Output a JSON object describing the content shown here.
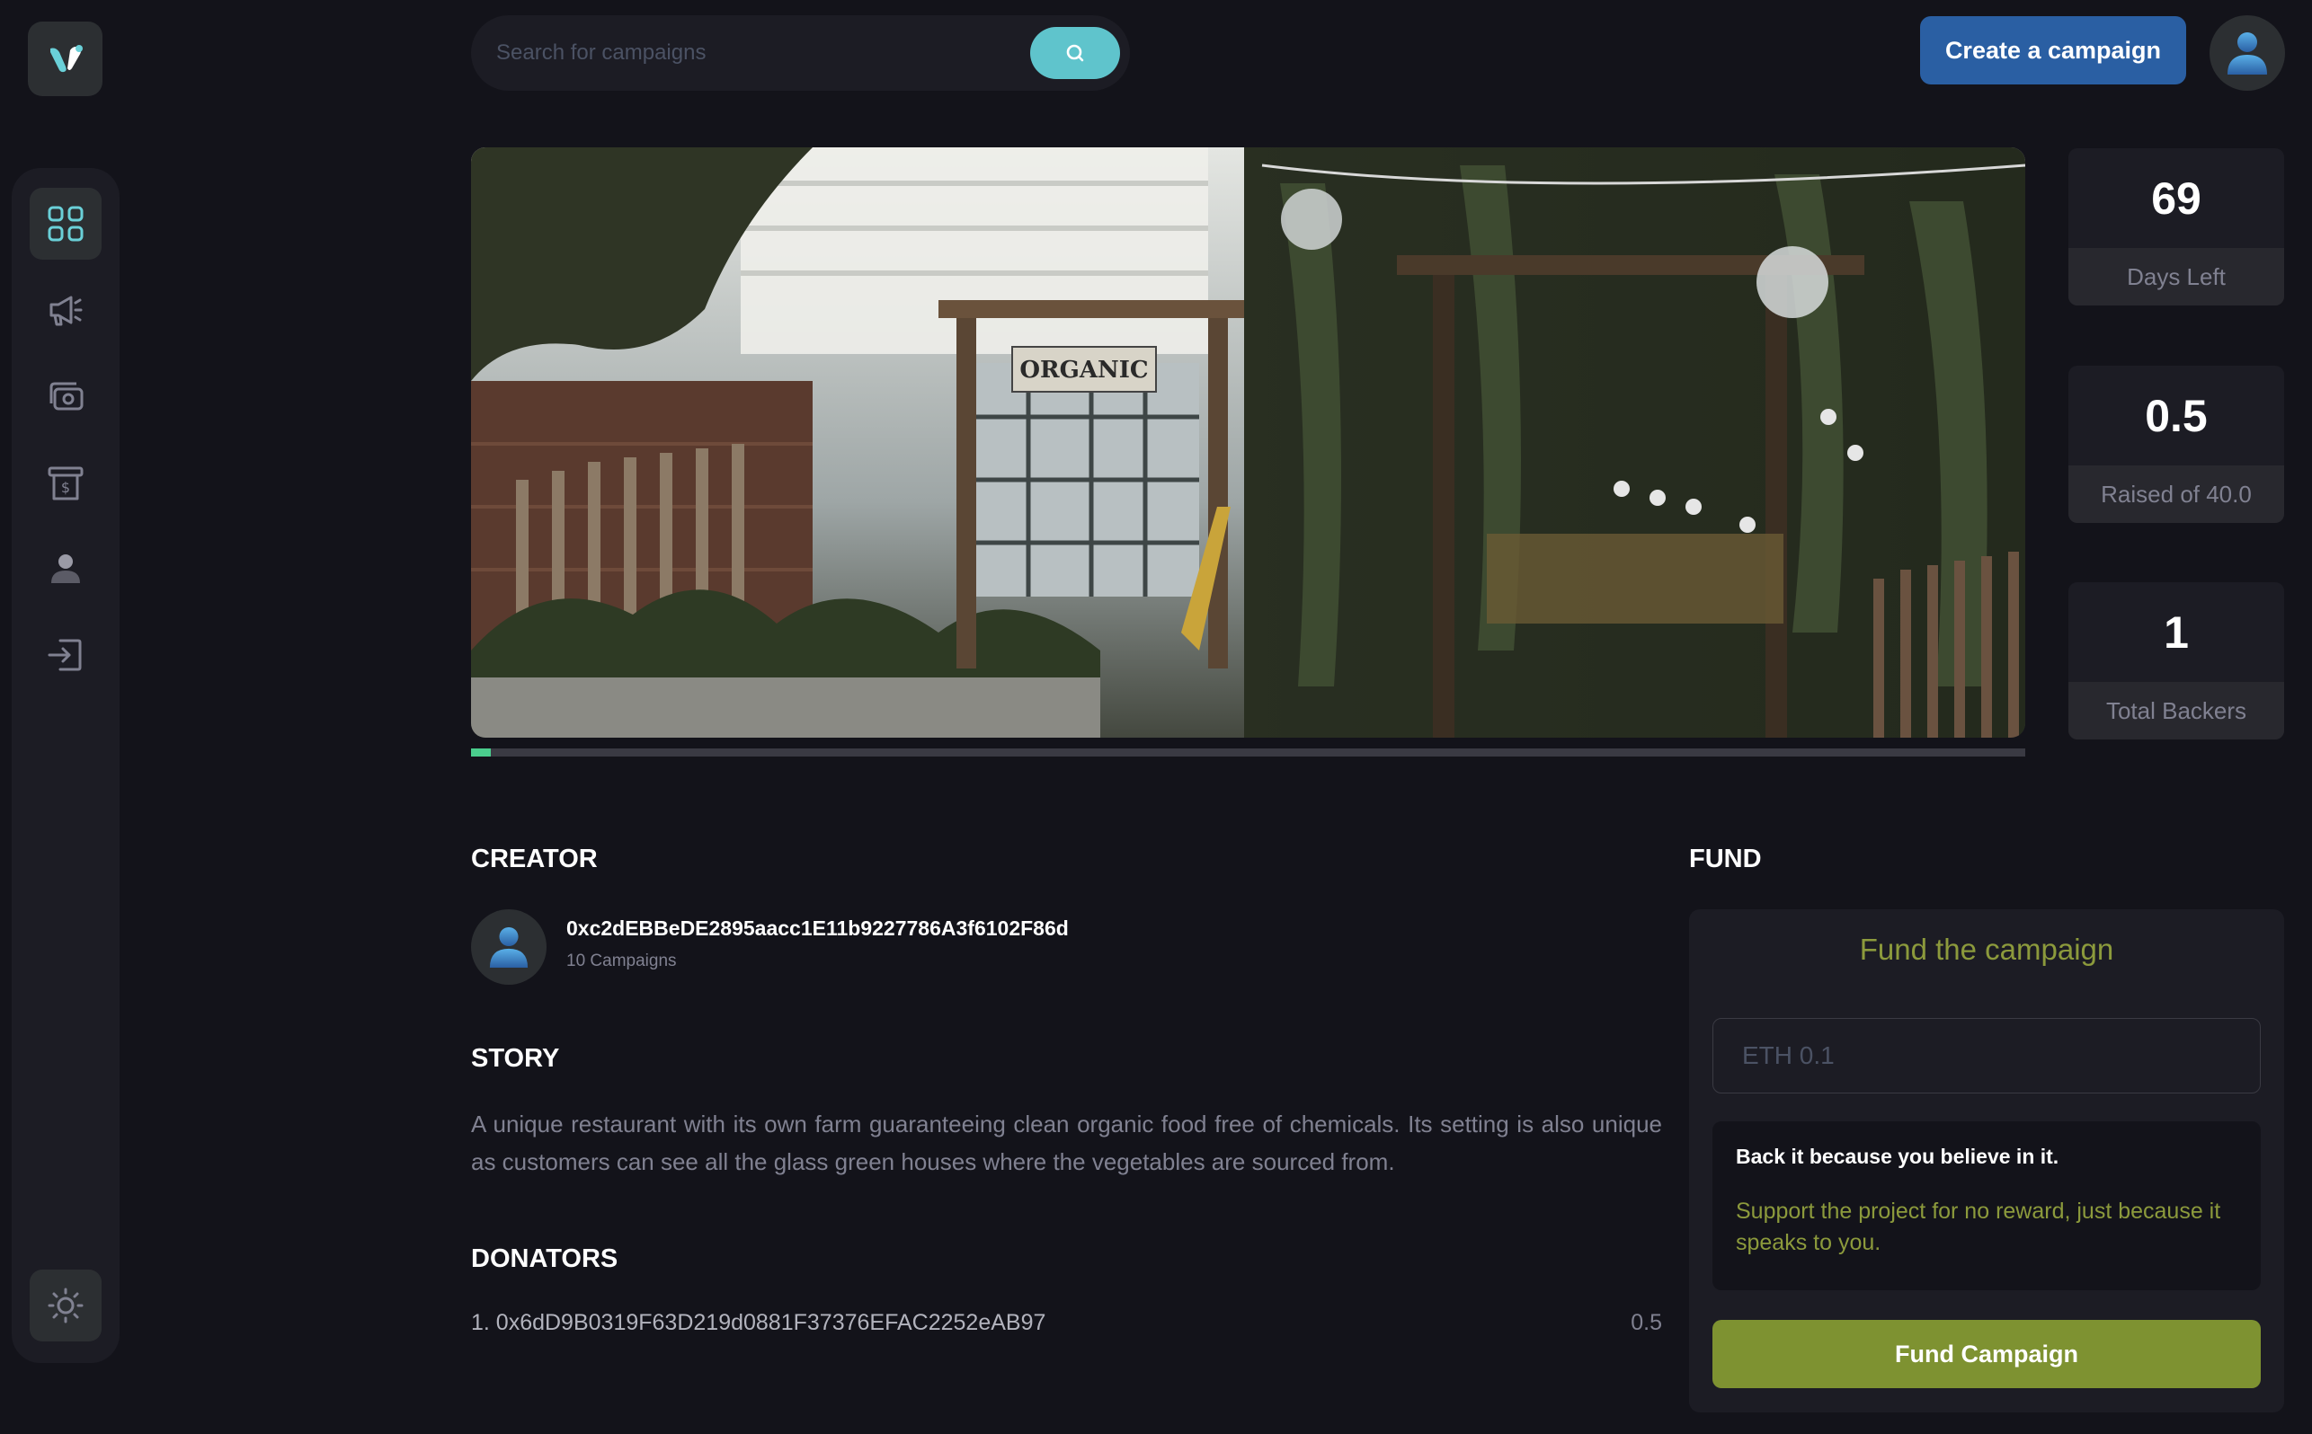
{
  "colors": {
    "background": "#13131a",
    "panel": "#1c1c24",
    "accent_green": "#4acd8d",
    "search_button": "#5fc4cc",
    "create_button": "#2a5fa3",
    "fund_button": "#7e9231",
    "olive_text": "#8c9a3c",
    "muted_text": "#808191"
  },
  "sidebar": {
    "items": [
      {
        "icon": "dashboard-icon",
        "active": true
      },
      {
        "icon": "megaphone-icon",
        "active": false
      },
      {
        "icon": "payment-icon",
        "active": false
      },
      {
        "icon": "withdraw-icon",
        "active": false
      },
      {
        "icon": "profile-icon",
        "active": false
      },
      {
        "icon": "logout-icon",
        "active": false
      }
    ],
    "theme_toggle_icon": "sun-icon"
  },
  "header": {
    "search_placeholder": "Search for campaigns",
    "search_icon": "search-icon",
    "create_label": "Create a campaign",
    "profile_icon": "user-avatar-icon"
  },
  "campaign": {
    "hero_sign": "ORGANIC",
    "progress_fraction": 0.0125,
    "stats": {
      "days_left_value": "69",
      "days_left_label": "Days Left",
      "raised_value": "0.5",
      "raised_label": "Raised of 40.0",
      "backers_value": "1",
      "backers_label": "Total Backers"
    },
    "creator": {
      "title": "Creator",
      "address": "0xc2dEBBeDE2895aacc1E11b9227786A3f6102F86d",
      "campaigns": "10 Campaigns"
    },
    "story": {
      "title": "Story",
      "text": "A unique restaurant with its own farm guaranteeing clean organic food free of chemicals. Its setting is also unique as customers can see all the glass green houses where the vegetables are sourced from."
    },
    "donators": {
      "title": "Donators",
      "list": [
        {
          "label": "1. 0x6dD9B0319F63D219d0881F37376EFAC2252eAB97",
          "amount": "0.5"
        }
      ]
    }
  },
  "fund": {
    "title": "Fund",
    "heading": "Fund the campaign",
    "input_placeholder": "ETH 0.1",
    "back_title": "Back it because you believe in it.",
    "back_text": "Support the project for no reward, just because it speaks to you.",
    "button_label": "Fund Campaign"
  }
}
